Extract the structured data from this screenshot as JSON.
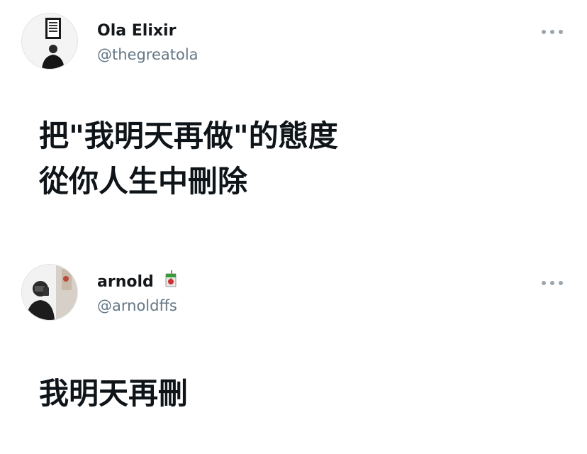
{
  "tweets": [
    {
      "display_name": "Ola Elixir",
      "handle": "@thegreatola",
      "avatar_icon": "profile-photo",
      "more_icon": "more-options-icon",
      "text_lines": [
        "把\"我明天再做\"的態度",
        "從你人生中刪除"
      ]
    },
    {
      "display_name": "arnold",
      "handle": "@arnoldffs",
      "avatar_icon": "profile-photo",
      "badge_icon": "juice-box-icon",
      "more_icon": "more-options-icon",
      "text_lines": [
        "我明天再刪"
      ]
    }
  ],
  "colors": {
    "text_primary": "#14171a",
    "text_secondary": "#657786",
    "more_dots": "#9aa5ae",
    "background": "#ffffff"
  }
}
